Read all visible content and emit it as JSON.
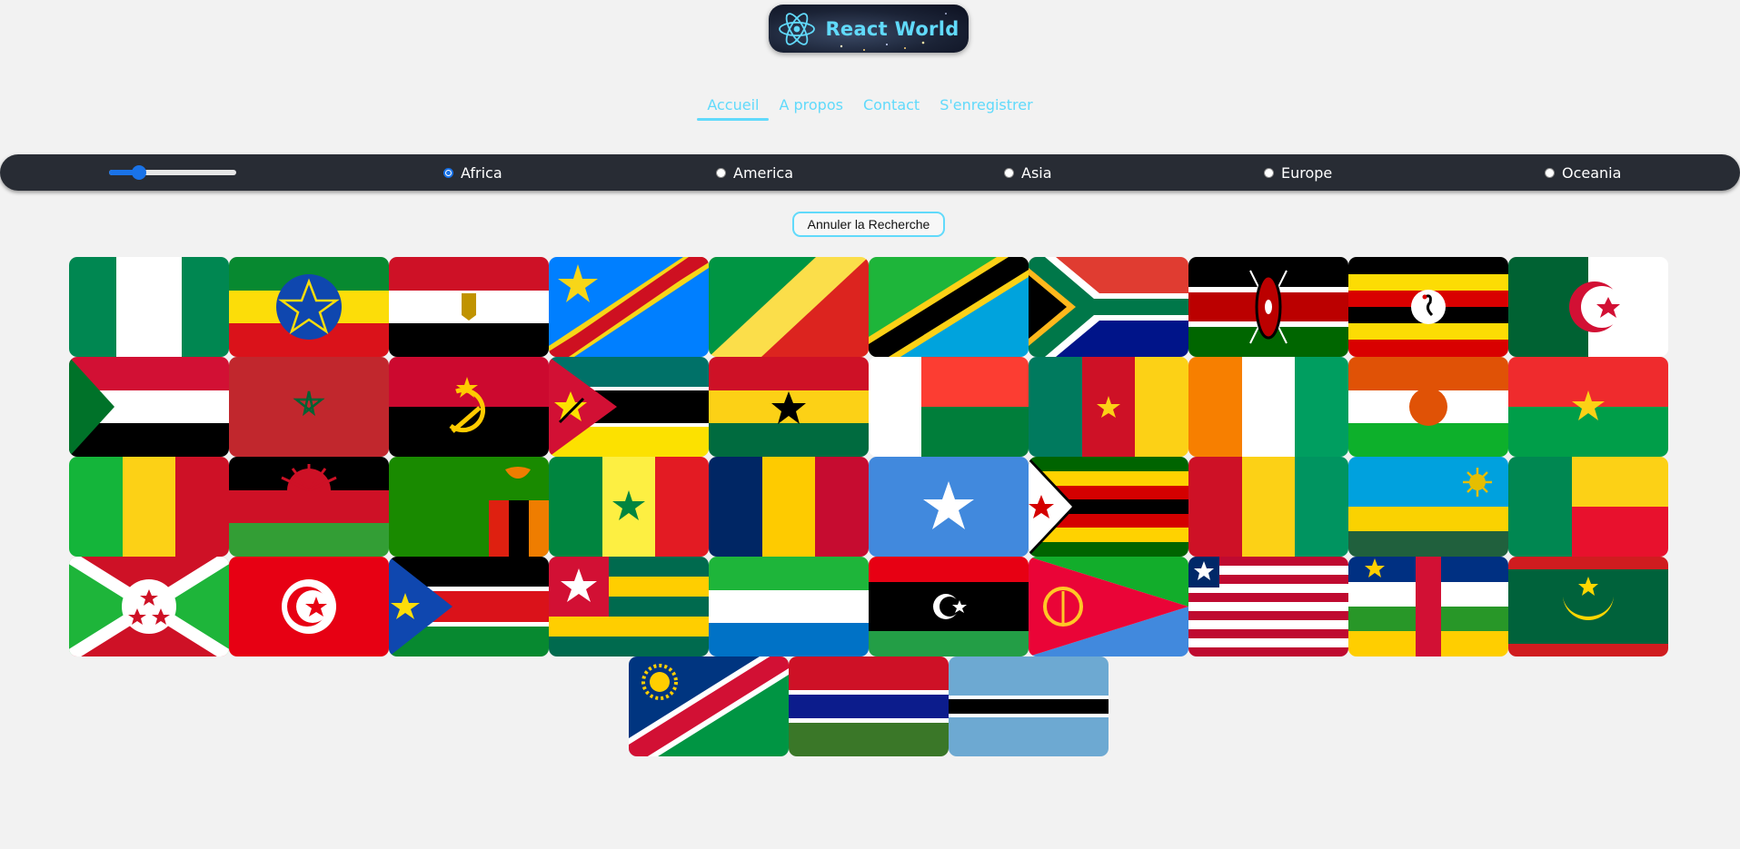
{
  "app": {
    "logo_text": "React World",
    "logo_icon": "react-atom-icon",
    "accent": "#61dafb"
  },
  "nav": {
    "items": [
      {
        "label": "Accueil",
        "active": true
      },
      {
        "label": "A propos",
        "active": false
      },
      {
        "label": "Contact",
        "active": false
      },
      {
        "label": "S'enregistrer",
        "active": false
      }
    ]
  },
  "filters": {
    "range_value_fraction": 0.2,
    "regions": [
      {
        "label": "Africa",
        "selected": true
      },
      {
        "label": "America",
        "selected": false
      },
      {
        "label": "Asia",
        "selected": false
      },
      {
        "label": "Europe",
        "selected": false
      },
      {
        "label": "Oceania",
        "selected": false
      }
    ]
  },
  "cancel_button": {
    "label": "Annuler la Recherche"
  },
  "flags": [
    "nigeria-flag",
    "ethiopia-flag",
    "egypt-flag",
    "dr-congo-flag",
    "congo-flag",
    "tanzania-flag",
    "south-africa-flag",
    "kenya-flag",
    "uganda-flag",
    "algeria-flag",
    "sudan-flag",
    "morocco-flag",
    "angola-flag",
    "mozambique-flag",
    "ghana-flag",
    "madagascar-flag",
    "cameroon-flag",
    "ivory-coast-flag",
    "niger-flag",
    "burkina-faso-flag",
    "mali-flag",
    "malawi-flag",
    "zambia-flag",
    "senegal-flag",
    "chad-flag",
    "somalia-flag",
    "zimbabwe-flag",
    "guinea-flag",
    "rwanda-flag",
    "benin-flag",
    "burundi-flag",
    "tunisia-flag",
    "south-sudan-flag",
    "togo-flag",
    "sierra-leone-flag",
    "libya-flag",
    "eritrea-flag",
    "liberia-flag",
    "central-african-republic-flag",
    "mauritania-flag",
    "namibia-flag",
    "gambia-flag",
    "botswana-flag"
  ]
}
